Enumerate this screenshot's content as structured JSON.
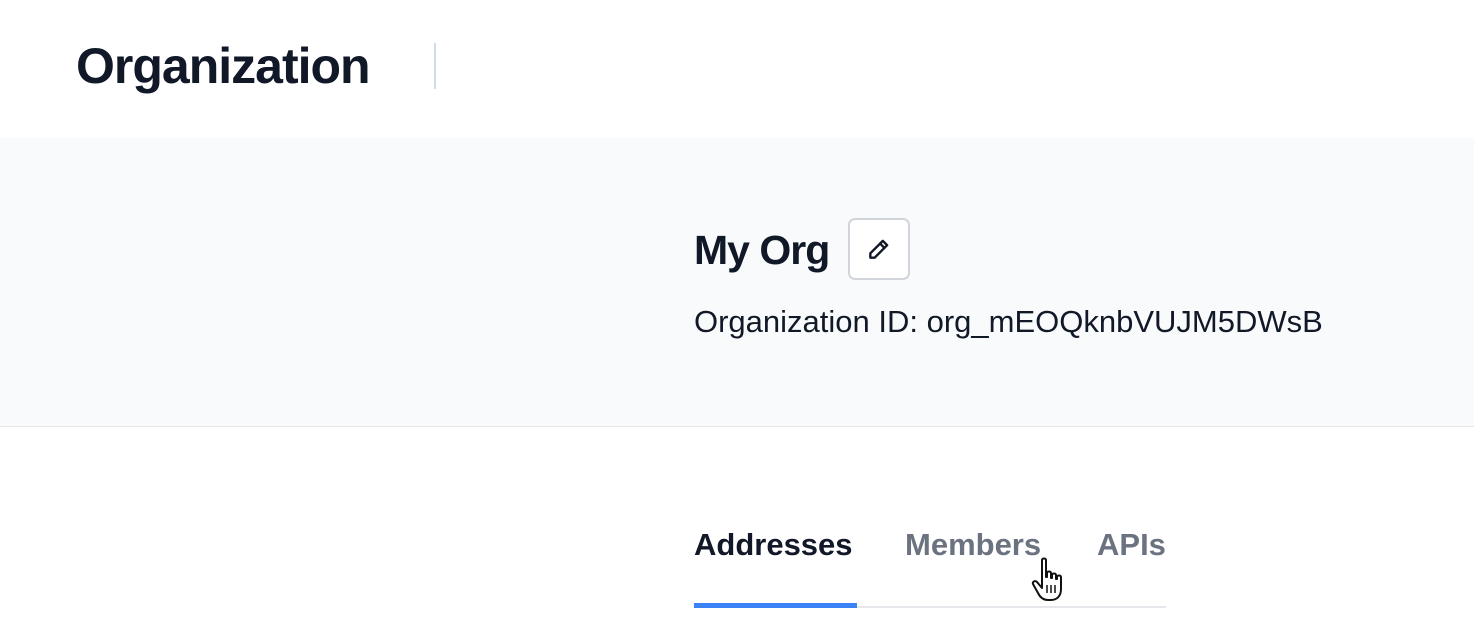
{
  "header": {
    "title": "Organization"
  },
  "org": {
    "name": "My Org",
    "id_label": "Organization ID: org_mEOQknbVUJM5DWsB",
    "edit_icon": "pencil-icon"
  },
  "tabs": [
    {
      "label": "Addresses",
      "active": true
    },
    {
      "label": "Members",
      "active": false
    },
    {
      "label": "APIs",
      "active": false
    }
  ],
  "colors": {
    "accent": "#3b82f6",
    "panel_bg": "#f9fafb",
    "text": "#111827",
    "muted": "#6b7280"
  }
}
